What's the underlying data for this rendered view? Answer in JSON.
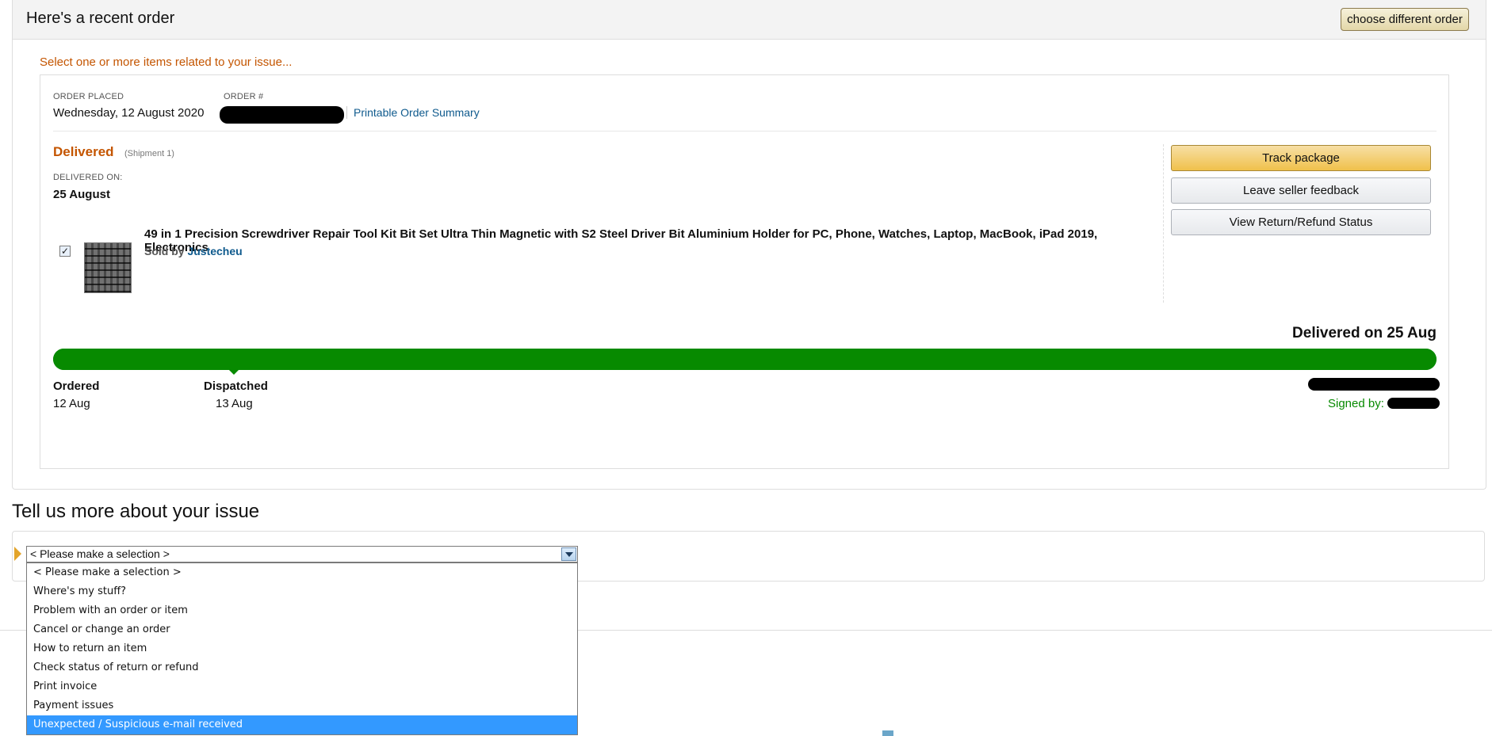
{
  "header": {
    "title": "Here's a recent order",
    "choose_button": "choose different order"
  },
  "select_hint": "Select one or more items related to your issue...",
  "order": {
    "placed_label": "ORDER PLACED",
    "placed_value": "Wednesday, 12 August 2020",
    "number_label": "ORDER #",
    "printable_link": "Printable Order Summary"
  },
  "shipment": {
    "status": "Delivered",
    "shipment_label": "(Shipment 1)",
    "delivered_on_label": "DELIVERED ON:",
    "delivered_on_value": "25 August"
  },
  "item": {
    "checked": true,
    "checkmark": "✓",
    "title": "49 in 1 Precision Screwdriver Repair Tool Kit Bit Set Ultra Thin Magnetic with S2 Steel Driver Bit Aluminium Holder for PC, Phone, Watches, Laptop, MacBook, iPad 2019, Electronics",
    "sold_by_label": "Sold by",
    "seller": "Justecheu"
  },
  "actions": {
    "track": "Track package",
    "feedback": "Leave seller feedback",
    "refund_status": "View Return/Refund Status"
  },
  "tracking": {
    "headline": "Delivered on 25 Aug",
    "progress": 1.0,
    "bar_color": "#078a00",
    "steps": [
      {
        "label": "Ordered",
        "date": "12 Aug"
      },
      {
        "label": "Dispatched",
        "date": "13 Aug"
      }
    ],
    "signed_by_label": "Signed by:"
  },
  "issue": {
    "title": "Tell us more about your issue",
    "select_value": "< Please make a selection >",
    "options": [
      "< Please make a selection >",
      "Where's my stuff?",
      "Problem with an order or item",
      "Cancel or change an order",
      "How to return an item",
      "Check status of return or refund",
      "Print invoice",
      "Payment issues",
      "Unexpected / Suspicious e-mail received"
    ],
    "highlighted_option": "Unexpected / Suspicious e-mail received"
  },
  "colors": {
    "accent_orange": "#c45500",
    "link_blue": "#0f5a8d",
    "progress_green": "#078a00",
    "dropdown_highlight": "#3399ff"
  }
}
